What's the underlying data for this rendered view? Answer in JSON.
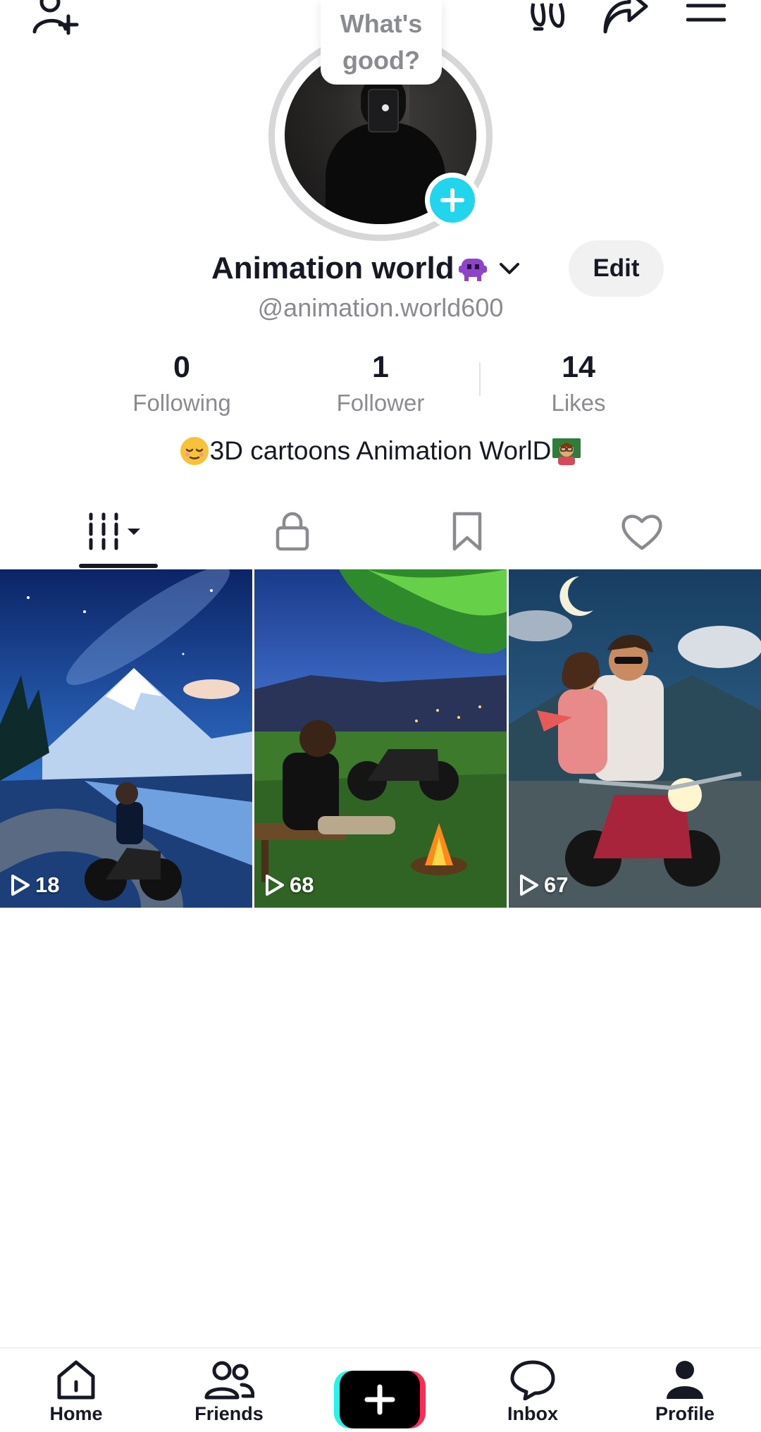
{
  "colors": {
    "accent_cyan": "#20d5ec",
    "brand_pink": "#fe2c55",
    "brand_aqua": "#25f4ee",
    "text_primary": "#161823",
    "text_secondary": "#8a8b91"
  },
  "topbar": {
    "add_friend_icon": "add-user-icon",
    "footprints_icon": "footprints-icon",
    "share_icon": "share-arrow-icon",
    "menu_icon": "hamburger-menu-icon"
  },
  "profile": {
    "note_bubble": [
      "What's",
      "good?"
    ],
    "display_name": "Animation world",
    "name_emoji": "alien-monster-emoji",
    "edit_label": "Edit",
    "username": "@animation.world600",
    "bio": "3D cartoons Animation WorlD",
    "bio_emojis": [
      "relieved-face-emoji",
      "teacher-emoji"
    ]
  },
  "stats": {
    "following": {
      "value": "0",
      "label": "Following"
    },
    "followers": {
      "value": "1",
      "label": "Follower"
    },
    "likes": {
      "value": "14",
      "label": "Likes"
    }
  },
  "tabs": [
    {
      "name": "videos",
      "icon": "grid-columns-icon",
      "active": true
    },
    {
      "name": "private",
      "icon": "lock-icon",
      "active": false
    },
    {
      "name": "saved",
      "icon": "bookmark-icon",
      "active": false
    },
    {
      "name": "liked",
      "icon": "heart-icon",
      "active": false
    }
  ],
  "videos": [
    {
      "views": "18",
      "scene": "motorcyclist on mountain road at night"
    },
    {
      "views": "68",
      "scene": "man on bench by campfire with motorcycle"
    },
    {
      "views": "67",
      "scene": "couple riding motorcycle under crescent moon"
    }
  ],
  "nav": {
    "home": "Home",
    "friends": "Friends",
    "create_icon": "plus-icon",
    "inbox": "Inbox",
    "profile": "Profile"
  }
}
